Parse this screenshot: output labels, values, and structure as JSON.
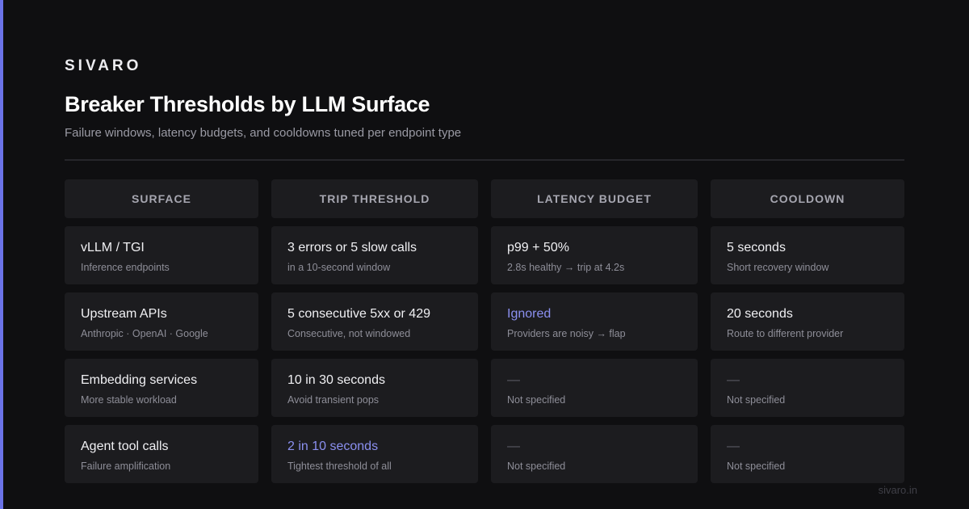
{
  "brand": "SIVARO",
  "title": "Breaker Thresholds by LLM Surface",
  "subtitle": "Failure windows, latency budgets, and cooldowns tuned per endpoint type",
  "columns": [
    "SURFACE",
    "TRIP THRESHOLD",
    "LATENCY BUDGET",
    "COOLDOWN"
  ],
  "rows": [
    [
      {
        "primary": "vLLM / TGI",
        "secondary": "Inference endpoints"
      },
      {
        "primary": "3 errors or 5 slow calls",
        "secondary": "in a 10-second window"
      },
      {
        "primary": "p99 + 50%",
        "secondary": "2.8s healthy → trip at 4.2s"
      },
      {
        "primary": "5 seconds",
        "secondary": "Short recovery window"
      }
    ],
    [
      {
        "primary": "Upstream APIs",
        "secondary": "Anthropic · OpenAI · Google"
      },
      {
        "primary": "5 consecutive 5xx or 429",
        "secondary": "Consecutive, not windowed"
      },
      {
        "primary": "Ignored",
        "secondary": "Providers are noisy → flap"
      },
      {
        "primary": "20 seconds",
        "secondary": "Route to different provider"
      }
    ],
    [
      {
        "primary": "Embedding services",
        "secondary": "More stable workload"
      },
      {
        "primary": "10 in 30 seconds",
        "secondary": "Avoid transient pops"
      },
      {
        "primary": "—",
        "secondary": "Not specified"
      },
      {
        "primary": "—",
        "secondary": "Not specified"
      }
    ],
    [
      {
        "primary": "Agent tool calls",
        "secondary": "Failure amplification"
      },
      {
        "primary": "2 in 10 seconds",
        "secondary": "Tightest threshold of all"
      },
      {
        "primary": "—",
        "secondary": "Not specified"
      },
      {
        "primary": "—",
        "secondary": "Not specified"
      }
    ]
  ],
  "footer": "sivaro.in",
  "colors": {
    "accent": "#6b73e8",
    "highlight": "#8b90f0",
    "background": "#0f0f11",
    "cell": "#1c1c1f"
  }
}
